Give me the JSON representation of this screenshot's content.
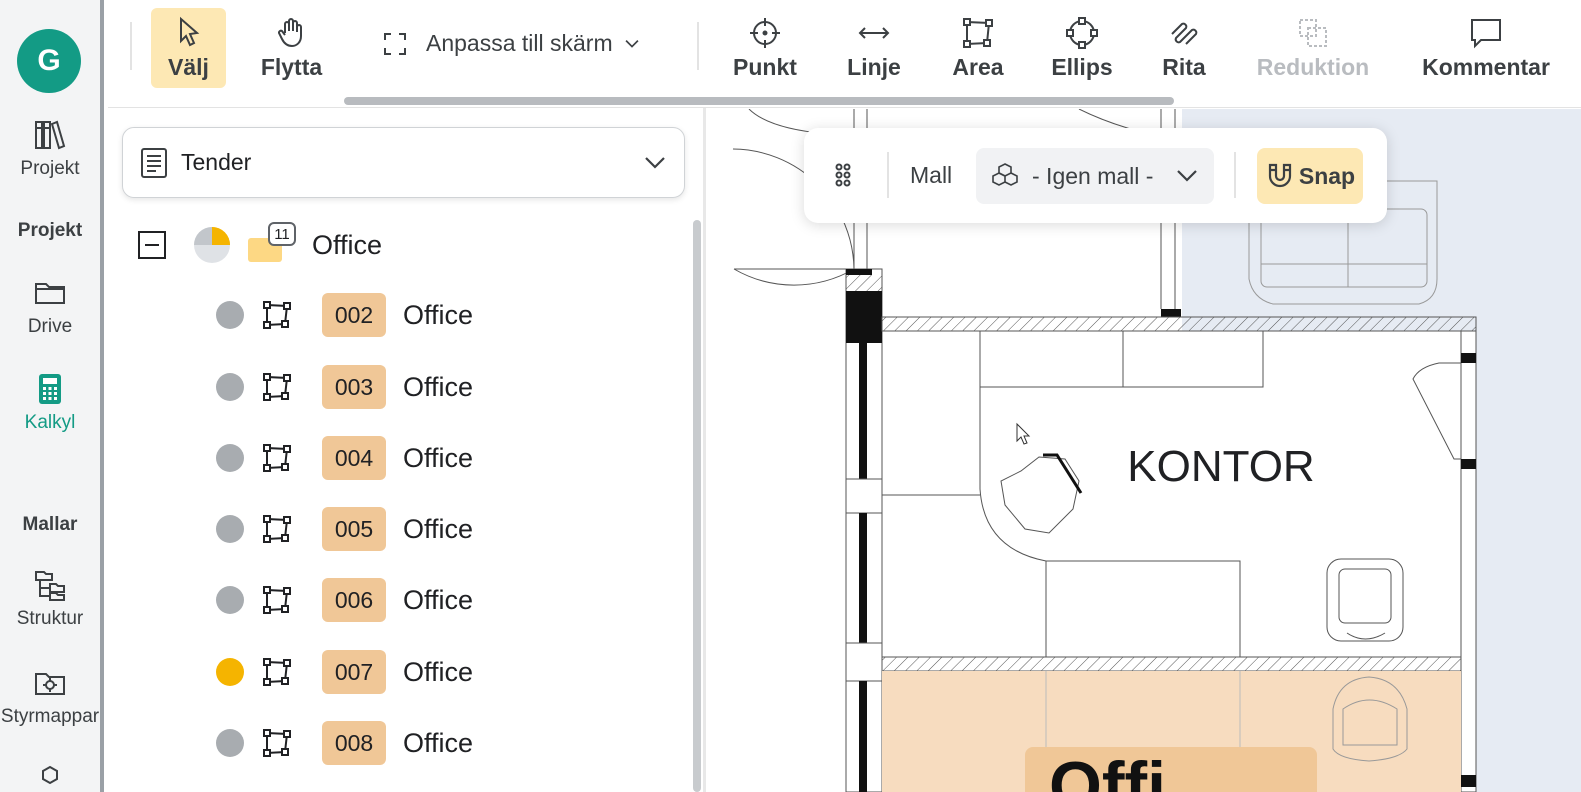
{
  "user": {
    "initial": "G"
  },
  "rail": {
    "projekt_top": "Projekt",
    "section_projekt": "Projekt",
    "drive": "Drive",
    "kalkyl": "Kalkyl",
    "section_mallar": "Mallar",
    "struktur": "Struktur",
    "styrmappar": "Styrmappar"
  },
  "toolbar": {
    "valj": "Välj",
    "flytta": "Flytta",
    "fit": "Anpassa till skärm",
    "punkt": "Punkt",
    "linje": "Linje",
    "area": "Area",
    "ellips": "Ellips",
    "rita": "Rita",
    "reduktion": "Reduktion",
    "kommentar": "Kommentar"
  },
  "panel": {
    "dropdown": "Tender",
    "group": {
      "label": "Office",
      "count": "11"
    },
    "rows": [
      {
        "code": "002",
        "label": "Office",
        "status": "gray"
      },
      {
        "code": "003",
        "label": "Office",
        "status": "gray"
      },
      {
        "code": "004",
        "label": "Office",
        "status": "gray"
      },
      {
        "code": "005",
        "label": "Office",
        "status": "gray"
      },
      {
        "code": "006",
        "label": "Office",
        "status": "gray"
      },
      {
        "code": "007",
        "label": "Office",
        "status": "yellow"
      },
      {
        "code": "008",
        "label": "Office",
        "status": "gray"
      }
    ]
  },
  "floating": {
    "mall_label": "Mall",
    "mall_value": "- Igen mall -",
    "snap": "Snap"
  },
  "drawing": {
    "room_label": "KONTOR",
    "partial_label": "Offi"
  },
  "colors": {
    "accent": "#139b85",
    "selected": "#fde8b4",
    "code_bg": "#f0c797",
    "room_fill": "#f7dcbf",
    "status_active": "#f5b400"
  }
}
